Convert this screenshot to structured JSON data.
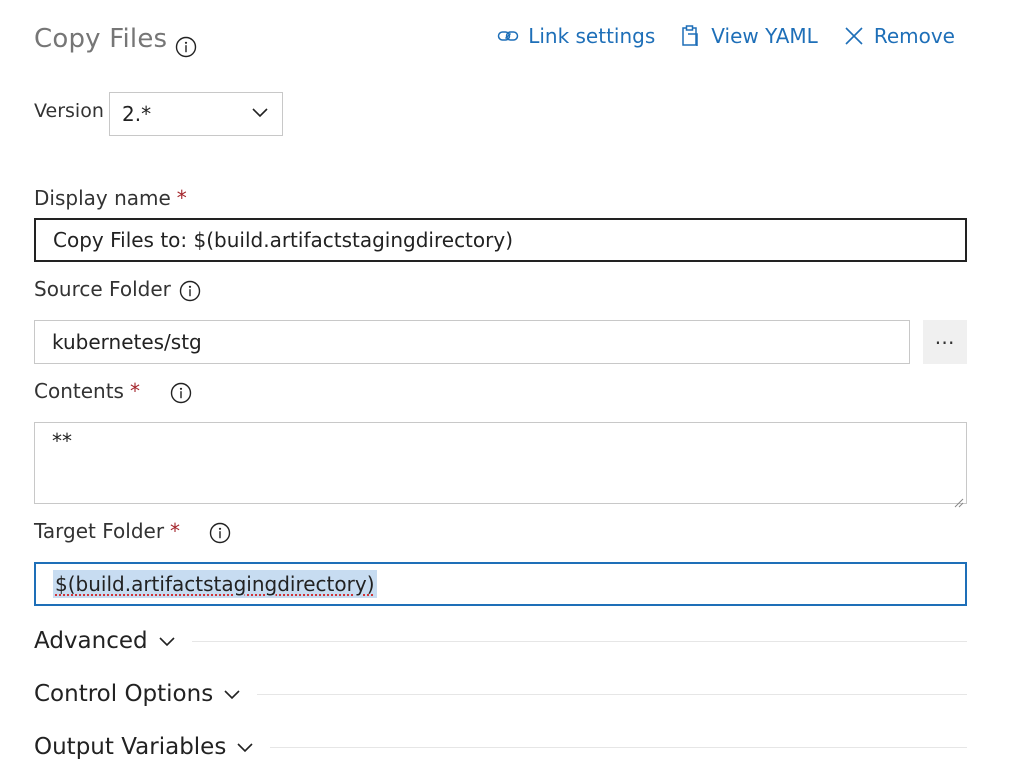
{
  "header": {
    "title": "Copy Files",
    "title_icon": "info-icon",
    "actions": [
      {
        "label": "Link settings",
        "icon": "link-icon"
      },
      {
        "label": "View YAML",
        "icon": "clipboard-icon"
      },
      {
        "label": "Remove",
        "icon": "close-icon"
      }
    ]
  },
  "version": {
    "label": "Version",
    "value": "2.*"
  },
  "fields": {
    "display_name": {
      "label": "Display name",
      "required": "*",
      "value": "Copy Files to: $(build.artifactstagingdirectory)"
    },
    "source_folder": {
      "label": "Source Folder",
      "value": "kubernetes/stg",
      "browse_label": "⋯"
    },
    "contents": {
      "label": "Contents",
      "required": "*",
      "value": "**"
    },
    "target_folder": {
      "label": "Target Folder",
      "required": "*",
      "value": "$(build.artifactstagingdirectory)"
    }
  },
  "sections": [
    {
      "label": "Advanced"
    },
    {
      "label": "Control Options"
    },
    {
      "label": "Output Variables"
    }
  ],
  "colors": {
    "accent": "#1e6fb8",
    "required": "#a4262c",
    "selection": "#c7dcf1"
  }
}
